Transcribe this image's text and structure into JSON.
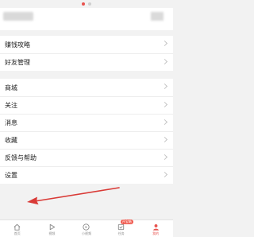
{
  "pager": {
    "active_index": 0,
    "count": 2
  },
  "groups": [
    {
      "items": [
        {
          "label": "赚钱攻略"
        },
        {
          "label": "好友管理"
        }
      ]
    },
    {
      "items": [
        {
          "label": "商城"
        },
        {
          "label": "关注"
        },
        {
          "label": "消息"
        },
        {
          "label": "收藏"
        },
        {
          "label": "反馈与帮助"
        },
        {
          "label": "设置"
        }
      ]
    }
  ],
  "annotation": {
    "color": "#d93a36"
  },
  "tabbar": {
    "items": [
      {
        "label": "首页",
        "icon": "home-icon",
        "active": false
      },
      {
        "label": "视频",
        "icon": "video-icon",
        "active": false
      },
      {
        "label": "小视频",
        "icon": "small-video-icon",
        "active": false
      },
      {
        "label": "任务",
        "icon": "task-icon",
        "active": false,
        "badge": "开宝箱"
      },
      {
        "label": "我的",
        "icon": "profile-icon",
        "active": true
      }
    ]
  },
  "colors": {
    "accent": "#e8534f",
    "background": "#f2f2f2"
  }
}
